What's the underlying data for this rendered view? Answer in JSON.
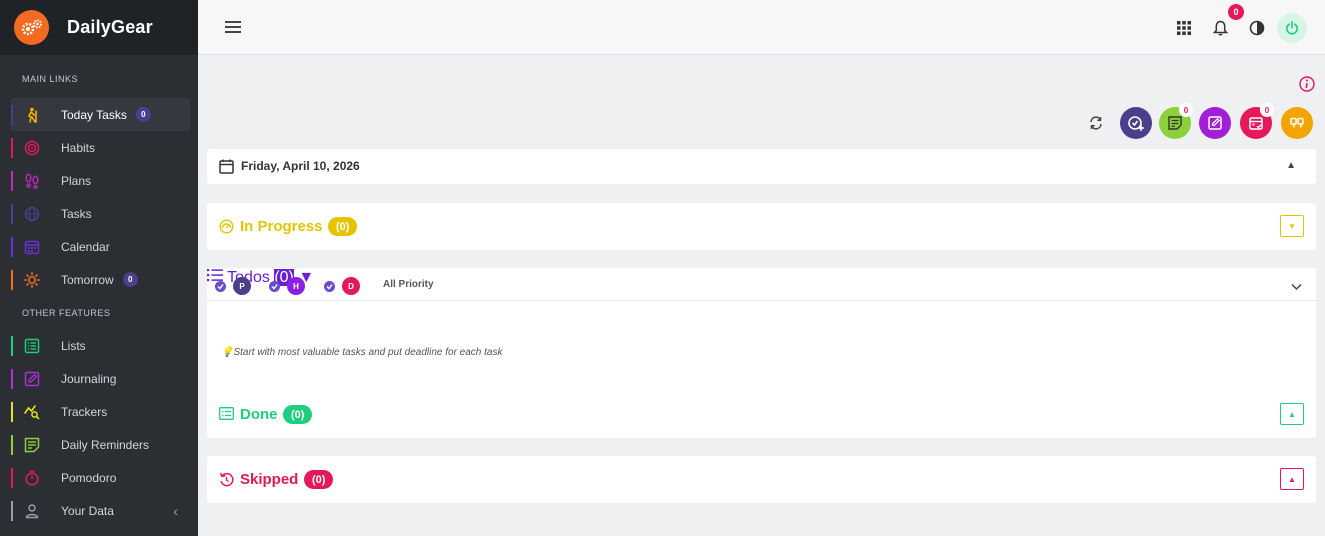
{
  "brand": {
    "title": "DailyGear"
  },
  "sidebar": {
    "main_label": "MAIN LINKS",
    "other_label": "OTHER FEATURES",
    "main_items": [
      {
        "label": "Today Tasks",
        "badge": "0",
        "color": "#f4b400"
      },
      {
        "label": "Habits",
        "color": "#e5195a"
      },
      {
        "label": "Plans",
        "color": "#c428c4"
      },
      {
        "label": "Tasks",
        "color": "#4b3f8c"
      },
      {
        "label": "Calendar",
        "color": "#6a2fd6"
      },
      {
        "label": "Tomorrow",
        "badge": "0",
        "color": "#f26b21"
      }
    ],
    "other_items": [
      {
        "label": "Lists",
        "color": "#1fcf7e"
      },
      {
        "label": "Journaling",
        "color": "#b02fd6"
      },
      {
        "label": "Trackers",
        "color": "#e8e21a"
      },
      {
        "label": "Daily Reminders",
        "color": "#8bd13a"
      },
      {
        "label": "Pomodoro",
        "color": "#e5195a"
      },
      {
        "label": "Your Data",
        "color": "#9aa0a6"
      }
    ]
  },
  "topbar": {
    "notifications_count": "0"
  },
  "actions": [
    {
      "icon": "refresh-icon"
    },
    {
      "icon": "add-task-icon",
      "color": "#4b3f8c"
    },
    {
      "icon": "notes-icon",
      "color": "#8bd13a",
      "badge": "0"
    },
    {
      "icon": "edit-icon",
      "color": "#a11fd6"
    },
    {
      "icon": "calendar-check-icon",
      "color": "#e5195a",
      "badge": "0"
    },
    {
      "icon": "quote-icon",
      "color": "#f4a400"
    }
  ],
  "date": {
    "text": "Friday, April 10, 2026"
  },
  "sections": {
    "in_progress": {
      "title": "In Progress",
      "count": "(0)",
      "color": "#e6c400"
    },
    "todos": {
      "title": "Todos",
      "count": "(0)",
      "color": "#6a1fd6",
      "tip": "💡Start with most valuable tasks and put deadline for each task"
    },
    "done": {
      "title": "Done",
      "count": "(0)",
      "color": "#1fcf7e"
    },
    "skipped": {
      "title": "Skipped",
      "count": "(0)",
      "color": "#e5195a"
    }
  },
  "filters": {
    "chips": [
      {
        "letter": "P",
        "color": "#4b3f8c"
      },
      {
        "letter": "H",
        "color": "#8a1fe6"
      },
      {
        "letter": "D",
        "color": "#e5195a"
      }
    ],
    "priority": "All Priority"
  }
}
